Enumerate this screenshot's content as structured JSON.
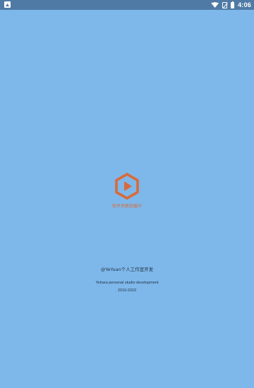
{
  "status_bar": {
    "time": "4:06",
    "icons": [
      "app-notification-icon",
      "wifi-icon",
      "no-sim-icon",
      "battery-icon"
    ]
  },
  "loader": {
    "icon": "play-hexagon-icon",
    "icon_color": "#D76B3C",
    "text": "软件页面加载中"
  },
  "credits": {
    "owner": "@YeYuan个人工作室开发",
    "studio": "Yehara personal studio development",
    "years": "2019-2022"
  },
  "colors": {
    "background": "#7EB8EA",
    "status_bar": "#4F7AA5",
    "accent": "#D76B3C"
  }
}
